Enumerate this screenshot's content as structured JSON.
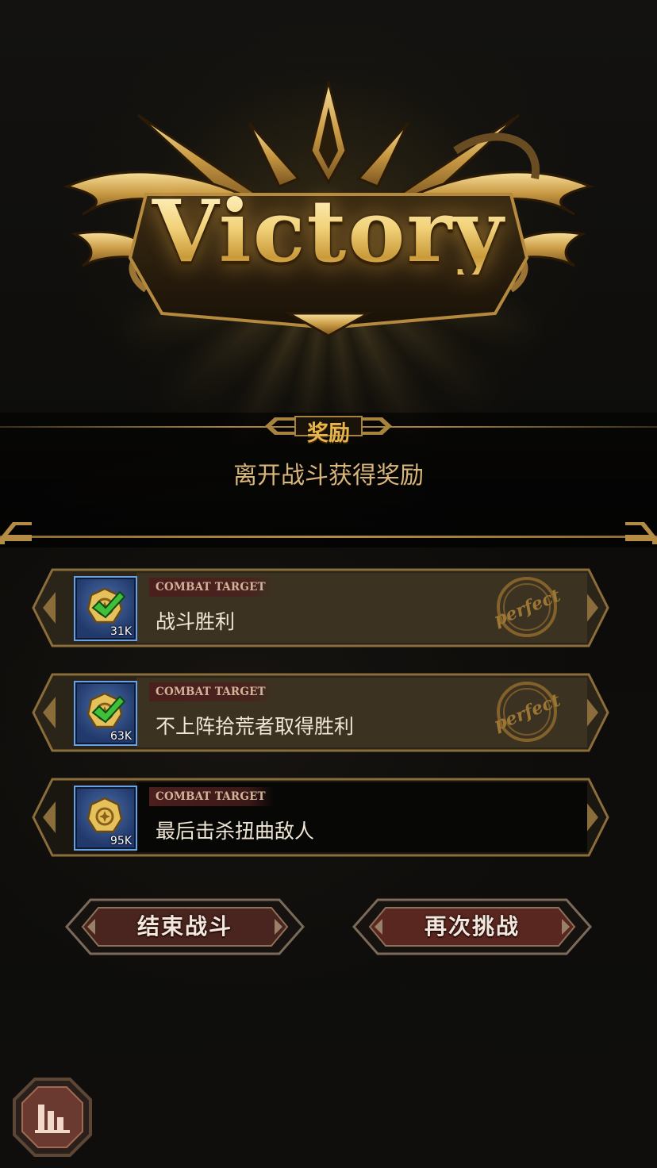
{
  "header": {
    "victory_text": "Victory"
  },
  "reward": {
    "title": "奖励",
    "subtitle": "离开战斗获得奖励"
  },
  "targets": [
    {
      "tag": "COMBAT TARGET",
      "description": "战斗胜利",
      "reward_count": "31K",
      "completed": true,
      "stamp_text": "perfect"
    },
    {
      "tag": "COMBAT TARGET",
      "description": "不上阵拾荒者取得胜利",
      "reward_count": "63K",
      "completed": true,
      "stamp_text": "perfect"
    },
    {
      "tag": "COMBAT TARGET",
      "description": "最后击杀扭曲敌人",
      "reward_count": "95K",
      "completed": false,
      "stamp_text": ""
    }
  ],
  "buttons": {
    "end_battle": "结束战斗",
    "retry": "再次挑战"
  },
  "icons": {
    "reward_item": "gold-coin-icon",
    "completed": "check-mark-icon",
    "stats": "bar-chart-icon"
  },
  "colors": {
    "gold": "#e7b64a",
    "button_red": "#5a2620",
    "frame_border": "#8a6d3b",
    "check_green": "#3fbf3a"
  }
}
